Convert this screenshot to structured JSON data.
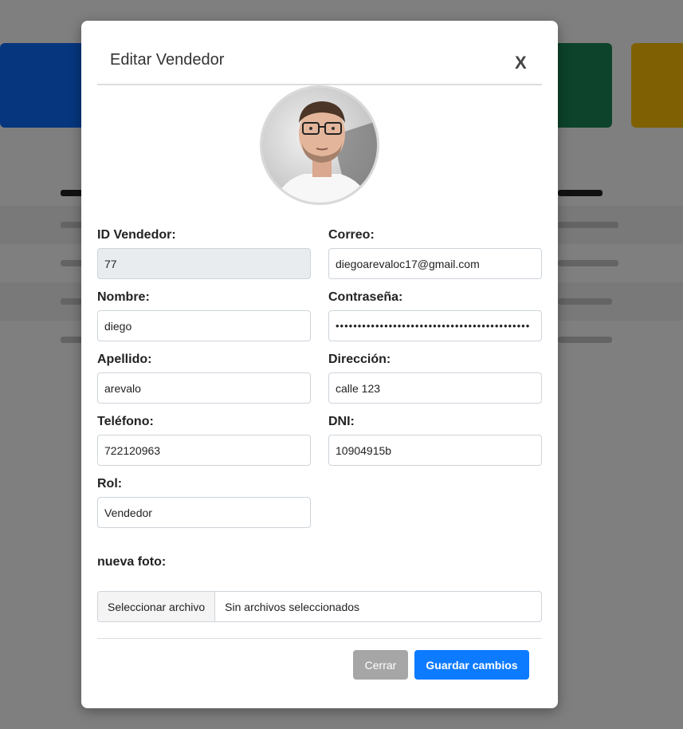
{
  "modal": {
    "title": "Editar Vendedor",
    "close_label": "X"
  },
  "form": {
    "id": {
      "label": "ID Vendedor:",
      "value": "77"
    },
    "correo": {
      "label": "Correo:",
      "value": "diegoarevaloc17@gmail.com"
    },
    "nombre": {
      "label": "Nombre:",
      "value": "diego"
    },
    "contrasena": {
      "label": "Contraseña:",
      "value": "••••••••••••••••••••••••••••••••••••••••••••"
    },
    "apellido": {
      "label": "Apellido:",
      "value": "arevalo"
    },
    "direccion": {
      "label": "Dirección:",
      "value": "calle 123"
    },
    "telefono": {
      "label": "Teléfono:",
      "value": "722120963"
    },
    "dni": {
      "label": "DNI:",
      "value": "10904915b"
    },
    "rol": {
      "label": "Rol:",
      "value": "Vendedor"
    },
    "foto": {
      "label": "nueva foto:",
      "button": "Seleccionar archivo",
      "status": "Sin archivos seleccionados"
    }
  },
  "footer": {
    "close_label": "Cerrar",
    "save_label": "Guardar cambios"
  },
  "colors": {
    "primary": "#0d7bff",
    "secondary": "#a6a6a6",
    "readonly_bg": "#e9ecef",
    "bg_blue": "#0d6efd",
    "bg_green": "#198754",
    "bg_yellow": "#ffc107"
  }
}
